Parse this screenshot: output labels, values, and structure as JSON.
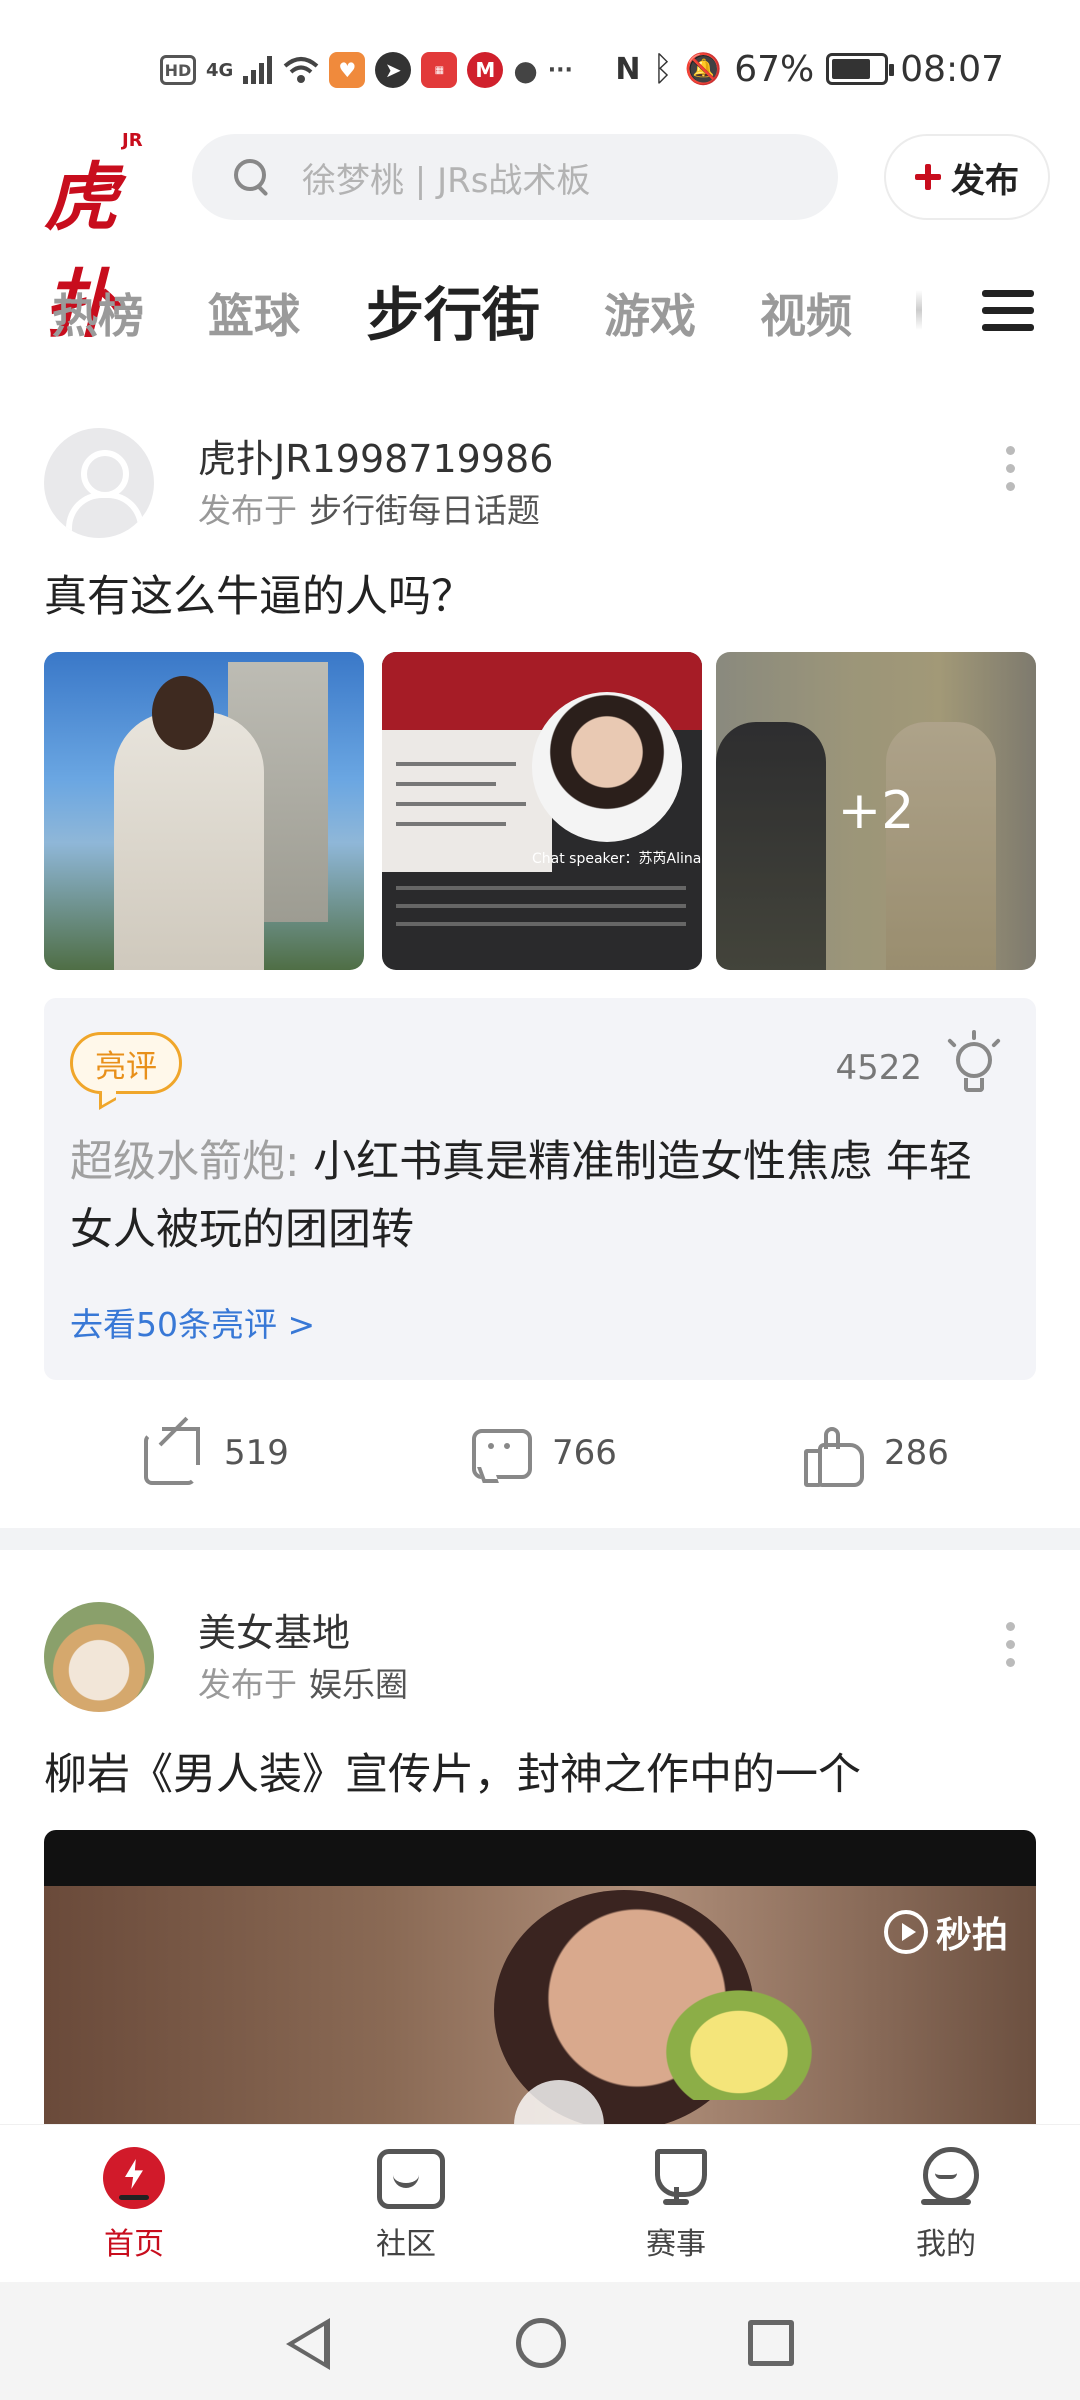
{
  "status_bar": {
    "hd": "HD",
    "network": "4G",
    "battery": "67%",
    "battery_level": 0.67,
    "time": "08:07",
    "app_icons": [
      "hd-icon",
      "signal-icon",
      "wifi-icon",
      "health-app-icon",
      "paper-plane-app-icon",
      "huawei-app-icon",
      "metro-app-icon",
      "wechat-icon",
      "more-icon"
    ],
    "system_icons": [
      "nfc-icon",
      "bluetooth-icon",
      "mute-bell-icon",
      "battery-icon"
    ]
  },
  "header": {
    "logo_text": "虎扑",
    "logo_badge": "JR",
    "search_placeholder": "徐梦桃 | JRs战术板",
    "publish_label": "发布",
    "accent_color": "#c80d1d"
  },
  "tabs": [
    {
      "label": "热榜",
      "active": false
    },
    {
      "label": "篮球",
      "active": false
    },
    {
      "label": "步行街",
      "active": true
    },
    {
      "label": "游戏",
      "active": false
    },
    {
      "label": "视频",
      "active": false
    }
  ],
  "posts": [
    {
      "author": "虎扑JR1998719986",
      "published_prefix": "发布于",
      "topic": "步行街每日话题",
      "title": "真有这么牛逼的人吗？",
      "images": [
        {
          "description": "woman-in-white-suit"
        },
        {
          "description": "chat-speaker-slide",
          "caption": "Chat speaker：苏芮Alina"
        },
        {
          "description": "women-in-gowns",
          "more_count": "+2"
        }
      ],
      "highlight": {
        "badge": "亮评",
        "light_count": "4522",
        "comment_author": "超级水箭炮:",
        "comment_text": "小红书真是精准制造女性焦虑 年轻女人被玩的团团转",
        "see_more": "去看50条亮评 >"
      },
      "actions": {
        "shares": "519",
        "comments": "766",
        "likes": "286"
      }
    },
    {
      "author": "美女基地",
      "published_prefix": "发布于",
      "topic": "娱乐圈",
      "title": "柳岩《男人装》宣传片，封神之作中的一个",
      "video_watermark": "秒拍"
    }
  ],
  "bottom_nav": [
    {
      "label": "首页",
      "icon": "home-bolt-icon",
      "active": true
    },
    {
      "label": "社区",
      "icon": "community-icon",
      "active": false
    },
    {
      "label": "赛事",
      "icon": "trophy-icon",
      "active": false
    },
    {
      "label": "我的",
      "icon": "profile-icon",
      "active": false
    }
  ]
}
